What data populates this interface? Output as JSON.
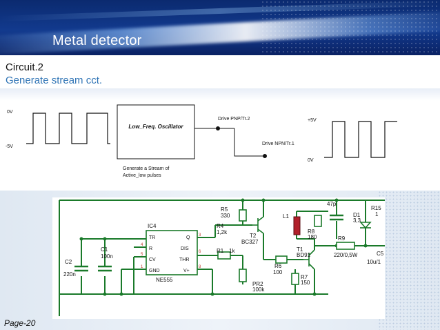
{
  "slide": {
    "title": "Metal detector",
    "subtitle": "Circuit.2",
    "subtitle2": "Generate stream cct.",
    "page_label": "Page-20"
  },
  "block_diagram": {
    "input_labels": [
      "0V",
      "-5V"
    ],
    "oscillator_label": "Low_Freq. Oscillator",
    "drive_pnp": "Drive PNP/Tr.2",
    "drive_npn": "Drive NPN/Tr.1",
    "output_labels": [
      "+5V",
      "0V"
    ],
    "caption_line1": "Generate a Stream of",
    "caption_line2": "Active_low pulses"
  },
  "schematic": {
    "ic_name": "IC4",
    "ic_part": "NE555",
    "pins_left": [
      "TR",
      "R",
      "CV",
      "GND"
    ],
    "pins_right": [
      "Q",
      "DIS",
      "THR",
      "V+"
    ],
    "components": {
      "r5": "R5",
      "r5_val": "330",
      "r4": "R4",
      "r4_val": "1,2k",
      "t2": "T2",
      "t2_part": "BC327",
      "l1": "L1",
      "r8": "R8",
      "r8_val": "180",
      "c47": "47p",
      "d1": "D1",
      "d1_val": "3,3",
      "r15": "R15",
      "r15_val": "1",
      "r1": "R1",
      "r1_val": "1k",
      "t1": "T1",
      "t1_part": "BD91",
      "r9": "R9",
      "r9_val": "220/0,5W",
      "c5": "C5",
      "c5_val": "10u/1",
      "c1": "C1",
      "c1_val": "100n",
      "c2": "C2",
      "c2_val": "220n",
      "r6": "R6",
      "r6_val": "100",
      "r7": "R7",
      "r7_val": "150",
      "pr2": "PR2",
      "pr2_val": "100k"
    }
  },
  "colors": {
    "header_dark": "#0b2a6f",
    "subtitle_blue": "#2f74b5",
    "schematic_green": "#1a7a2a",
    "schematic_red": "#c0392b",
    "inductor_fill": "#b0202a"
  }
}
